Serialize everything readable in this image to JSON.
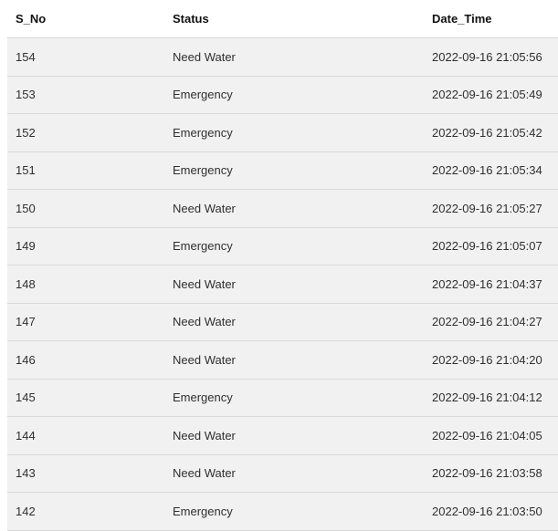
{
  "table": {
    "headers": [
      "S_No",
      "Status",
      "Date_Time"
    ],
    "rows": [
      [
        "154",
        "Need Water",
        "2022-09-16 21:05:56"
      ],
      [
        "153",
        "Emergency",
        "2022-09-16 21:05:49"
      ],
      [
        "152",
        "Emergency",
        "2022-09-16 21:05:42"
      ],
      [
        "151",
        "Emergency",
        "2022-09-16 21:05:34"
      ],
      [
        "150",
        "Need Water",
        "2022-09-16 21:05:27"
      ],
      [
        "149",
        "Emergency",
        "2022-09-16 21:05:07"
      ],
      [
        "148",
        "Need Water",
        "2022-09-16 21:04:37"
      ],
      [
        "147",
        "Need Water",
        "2022-09-16 21:04:27"
      ],
      [
        "146",
        "Need Water",
        "2022-09-16 21:04:20"
      ],
      [
        "145",
        "Emergency",
        "2022-09-16 21:04:12"
      ],
      [
        "144",
        "Need Water",
        "2022-09-16 21:04:05"
      ],
      [
        "143",
        "Need Water",
        "2022-09-16 21:03:58"
      ],
      [
        "142",
        "Emergency",
        "2022-09-16 21:03:50"
      ]
    ]
  }
}
